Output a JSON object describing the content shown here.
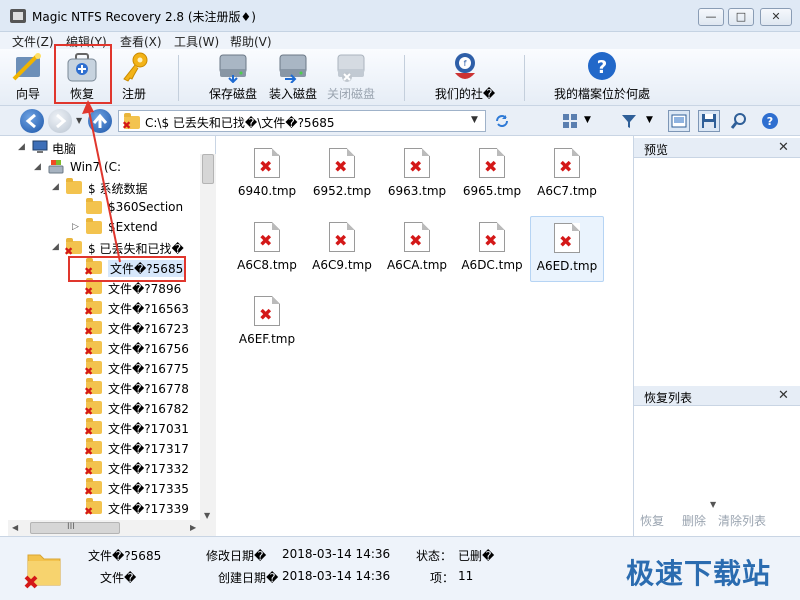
{
  "window": {
    "title": "Magic NTFS Recovery 2.8 (未注册版♦)",
    "min_glyph": "—",
    "max_glyph": "□",
    "close_glyph": "✕"
  },
  "menu": [
    "文件(Z)",
    "编辑(Y)",
    "查看(X)",
    "工具(W)",
    "帮助(V)"
  ],
  "toolbar": {
    "wizard": "向导",
    "recover": "恢复",
    "register": "注册",
    "save_disk": "保存磁盘",
    "load_disk": "装入磁盘",
    "close_disk": "关闭磁盘",
    "our_social": "我们的社�",
    "my_files": "我的檔案位於何處"
  },
  "address": {
    "path": "C:\\$ 已丢失和已找�\\文件�?5685"
  },
  "tree": {
    "computer": "电脑",
    "drive": "Win7 (C:",
    "system_data": "$ 系统数据",
    "section": "$360Section",
    "extend": "$Extend",
    "lost_found": "$ 已丢失和已找�",
    "items": [
      "文件�?5685",
      "文件�?7896",
      "文件�?16563",
      "文件�?16723",
      "文件�?16756",
      "文件�?16775",
      "文件�?16778",
      "文件�?16782",
      "文件�?17031",
      "文件�?17317",
      "文件�?17332",
      "文件�?17335",
      "文件�?17339"
    ],
    "hscroll_glyph": "III"
  },
  "files": [
    "6940.tmp",
    "6952.tmp",
    "6963.tmp",
    "6965.tmp",
    "A6C7.tmp",
    "A6C8.tmp",
    "A6C9.tmp",
    "A6CA.tmp",
    "A6DC.tmp",
    "A6ED.tmp",
    "A6EF.tmp"
  ],
  "panels": {
    "preview": "预览",
    "recover_list": "恢复列表",
    "recover_btn": "恢复",
    "delete_btn": "删除",
    "clear_btn": "清除列表"
  },
  "status": {
    "name": "文件�?5685",
    "type": "文件�",
    "modified_label": "修改日期�",
    "modified_value": "2018-03-14 14:36",
    "created_label": "创建日期�",
    "created_value": "2018-03-14 14:36",
    "state_label": "状态：",
    "state_value": "已删�",
    "items_label": "项：",
    "items_value": "11"
  },
  "watermark": "极速下载站",
  "colors": {
    "highlight": "#e0362d",
    "folder": "#f3c34e",
    "deleted_x": "#d41818"
  }
}
